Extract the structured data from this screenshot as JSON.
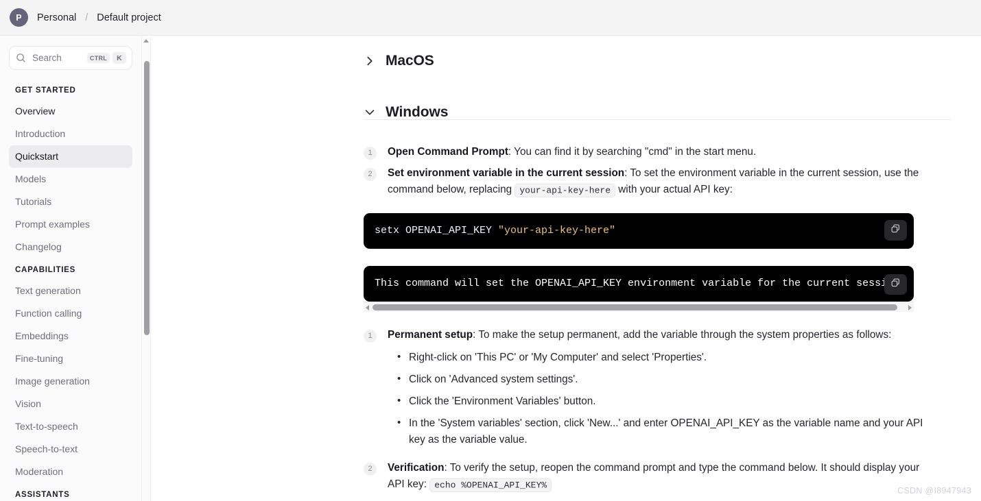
{
  "topbar": {
    "avatar_initial": "P",
    "org": "Personal",
    "separator": "/",
    "project": "Default project",
    "avatar_color": "#64647a",
    "background": "#f4f4f4"
  },
  "sidebar": {
    "search": {
      "placeholder": "Search",
      "icon": "search-icon",
      "kbd_modifier": "CTRL",
      "kbd_key": "K"
    },
    "sections": [
      {
        "label": "GET STARTED",
        "items": [
          {
            "label": "Overview",
            "active": false,
            "emphasis": true
          },
          {
            "label": "Introduction",
            "active": false,
            "emphasis": false
          },
          {
            "label": "Quickstart",
            "active": true,
            "emphasis": false
          },
          {
            "label": "Models",
            "active": false,
            "emphasis": false
          },
          {
            "label": "Tutorials",
            "active": false,
            "emphasis": false
          },
          {
            "label": "Prompt examples",
            "active": false,
            "emphasis": false
          },
          {
            "label": "Changelog",
            "active": false,
            "emphasis": false
          }
        ]
      },
      {
        "label": "CAPABILITIES",
        "items": [
          {
            "label": "Text generation",
            "active": false,
            "emphasis": false
          },
          {
            "label": "Function calling",
            "active": false,
            "emphasis": false
          },
          {
            "label": "Embeddings",
            "active": false,
            "emphasis": false
          },
          {
            "label": "Fine-tuning",
            "active": false,
            "emphasis": false
          },
          {
            "label": "Image generation",
            "active": false,
            "emphasis": false
          },
          {
            "label": "Vision",
            "active": false,
            "emphasis": false
          },
          {
            "label": "Text-to-speech",
            "active": false,
            "emphasis": false
          },
          {
            "label": "Speech-to-text",
            "active": false,
            "emphasis": false
          },
          {
            "label": "Moderation",
            "active": false,
            "emphasis": false
          }
        ]
      },
      {
        "label": "ASSISTANTS",
        "items": []
      }
    ]
  },
  "main": {
    "macos": {
      "title": "MacOS",
      "expanded": false,
      "chevron": "chevron-right-icon"
    },
    "windows": {
      "title": "Windows",
      "expanded": true,
      "chevron": "chevron-down-icon",
      "steps_top": [
        {
          "num": "1",
          "title": "Open Command Prompt",
          "text": ": You can find it by searching \"cmd\" in the start menu."
        },
        {
          "num": "2",
          "title": "Set environment variable in the current session",
          "text_before": ": To set the environment variable in the current session, use the command below, replacing ",
          "code": "your-api-key-here",
          "text_after": " with your actual API key:"
        }
      ],
      "code_blocks": [
        {
          "command": "setx OPENAI_API_KEY ",
          "string": "\"your-api-key-here\"",
          "copy_icon": "copy-icon"
        },
        {
          "text": "This command will set the OPENAI_API_KEY environment variable for the current sessi",
          "copy_icon": "copy-icon",
          "has_hscrollbar": true
        }
      ],
      "steps_bottom": [
        {
          "num": "1",
          "title": "Permanent setup",
          "text": ": To make the setup permanent, add the variable through the system properties as follows:",
          "bullets": [
            "Right-click on 'This PC' or 'My Computer' and select 'Properties'.",
            "Click on 'Advanced system settings'.",
            "Click the 'Environment Variables' button.",
            "In the 'System variables' section, click 'New...' and enter OPENAI_API_KEY as the variable name and your API key as the variable value."
          ]
        },
        {
          "num": "2",
          "title": "Verification",
          "text_before": ": To verify the setup, reopen the command prompt and type the command below. It should display your API key: ",
          "code": "echo %OPENAI_API_KEY%"
        }
      ]
    }
  },
  "watermark": "CSDN @I8947943"
}
